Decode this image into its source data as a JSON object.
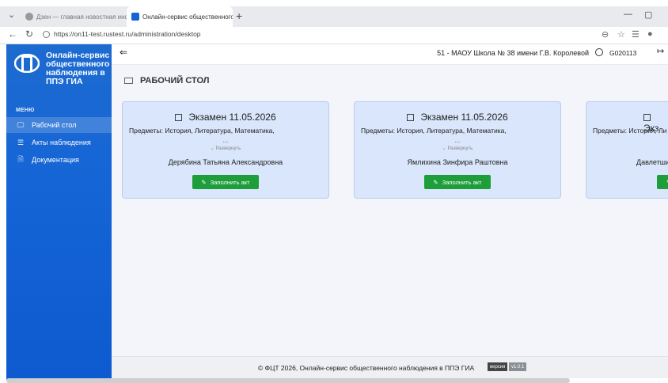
{
  "browser": {
    "tabs": [
      {
        "label": "Дзен — главная новостная инф...",
        "active": false
      },
      {
        "label": "Онлайн-сервис общественного ...",
        "active": true
      }
    ],
    "url": "https://on11-test.rustest.ru/administration/desktop",
    "icons": [
      "chevron-down-icon",
      "close-icon",
      "plus-icon",
      "minimize-icon",
      "maximize-icon",
      "back-icon",
      "refresh-icon",
      "lock-icon",
      "zoom-icon",
      "star-icon",
      "favorites-icon",
      "profile-icon"
    ]
  },
  "sidebar": {
    "logo_text": "Онлайн-сервис общественного наблюдения в ППЭ ГИА",
    "menu_title": "МЕНЮ",
    "items": [
      {
        "label": "Рабочий стол",
        "icon": "monitor-icon",
        "active": true
      },
      {
        "label": "Акты наблюдения",
        "icon": "list-icon",
        "active": false
      },
      {
        "label": "Документация",
        "icon": "document-icon",
        "active": false
      }
    ],
    "bg_color": "#1565d6"
  },
  "header": {
    "school": "51 - МАОУ Школа № 38 имени Г.В. Королевой",
    "user_code": "G020113"
  },
  "page": {
    "title": "РАБОЧИЙ СТОЛ"
  },
  "cards": [
    {
      "title": "Экзамен 11.05.2026",
      "subjects": "Предметы: История, Литература, Математика,",
      "dots": "...",
      "expand": "Развернуть",
      "person": "Дерябина Татьяна Александровна",
      "button": "Заполнить акт"
    },
    {
      "title": "Экзамен 11.05.2026",
      "subjects": "Предметы: История, Литература, Математика,",
      "dots": "...",
      "expand": "Развернуть",
      "person": "Ямлихина Зинфира Раштовна",
      "button": "Заполнить акт"
    },
    {
      "title": "Экз",
      "subjects": "Предметы: История, Ли",
      "dots": "",
      "expand": "",
      "person": "Давлетши",
      "button": ""
    }
  ],
  "footer": {
    "text": "© ФЦТ 2026, Онлайн-сервис общественного наблюдения в ППЭ ГИА",
    "version_label": "версия",
    "version": "v1.0.1"
  },
  "colors": {
    "accent": "#1565d6",
    "card_bg": "#d9e6fb",
    "button": "#1e9e3a"
  }
}
